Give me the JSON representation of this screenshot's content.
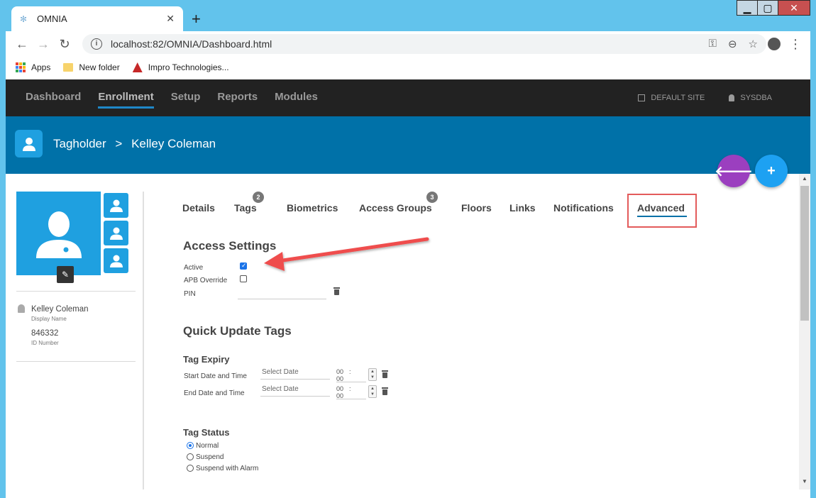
{
  "browser": {
    "tab_title": "OMNIA",
    "url": "localhost:82/OMNIA/Dashboard.html",
    "bookmarks": [
      "Apps",
      "New folder",
      "Impro Technologies..."
    ]
  },
  "appnav": {
    "items": [
      "Dashboard",
      "Enrollment",
      "Setup",
      "Reports",
      "Modules"
    ],
    "site": "DEFAULT SITE",
    "user": "SYSDBA"
  },
  "header": {
    "section": "Tagholder",
    "separator": ">",
    "name": "Kelley Coleman"
  },
  "person": {
    "display_name": "Kelley Coleman",
    "display_name_label": "Display Name",
    "id_number": "846332",
    "id_number_label": "ID Number"
  },
  "tabs": {
    "details": "Details",
    "tags": "Tags",
    "tags_count": "2",
    "biometrics": "Biometrics",
    "access_groups": "Access Groups",
    "access_groups_count": "3",
    "floors": "Floors",
    "links": "Links",
    "notifications": "Notifications",
    "advanced": "Advanced"
  },
  "access_settings": {
    "title": "Access Settings",
    "active_label": "Active",
    "active_checked": true,
    "apb_label": "APB Override",
    "apb_checked": false,
    "pin_label": "PIN"
  },
  "quick_update": {
    "title": "Quick Update Tags",
    "tag_expiry_title": "Tag Expiry",
    "start_label": "Start Date and Time",
    "end_label": "End Date and Time",
    "date_placeholder": "Select Date",
    "hour": "00",
    "colon": ":",
    "minute": "00",
    "tag_status_title": "Tag Status",
    "status_options": [
      "Normal",
      "Suspend",
      "Suspend with Alarm"
    ],
    "status_selected": "Normal"
  },
  "colors": {
    "accent_blue": "#0071a8",
    "tile_blue": "#1fa0e0",
    "fab_purple": "#9b3fbf",
    "fab_blue": "#1da1f2",
    "highlight_red": "#e35b5b"
  }
}
